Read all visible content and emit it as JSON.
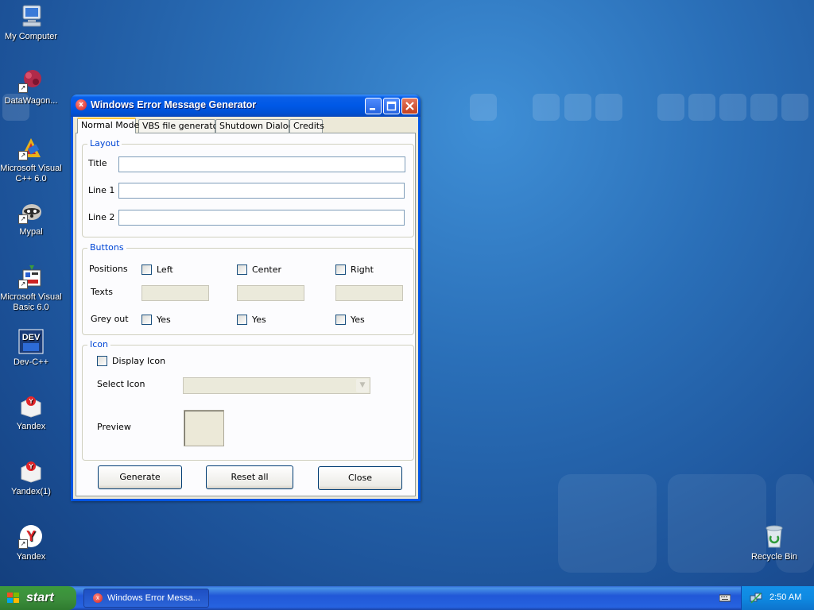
{
  "desktop": {
    "icons": [
      {
        "label": "My Computer"
      },
      {
        "label": "DataWagon..."
      },
      {
        "label": "Microsoft Visual C++ 6.0"
      },
      {
        "label": "Mypal"
      },
      {
        "label": "Microsoft Visual Basic 6.0"
      },
      {
        "label": "Dev-C++"
      },
      {
        "label": "Yandex"
      },
      {
        "label": "Yandex(1)"
      },
      {
        "label": "Yandex"
      },
      {
        "label": "Recycle Bin"
      }
    ]
  },
  "window": {
    "title": "Windows Error Message Generator",
    "tabs": [
      {
        "label": "Normal Mode",
        "active": true
      },
      {
        "label": "VBS file generator",
        "active": false
      },
      {
        "label": "Shutdown Dialog",
        "active": false
      },
      {
        "label": "Credits",
        "active": false
      }
    ],
    "layout_group": {
      "legend": "Layout",
      "title_label": "Title",
      "title_value": "",
      "line1_label": "Line 1",
      "line1_value": "",
      "line2_label": "Line 2",
      "line2_value": ""
    },
    "buttons_group": {
      "legend": "Buttons",
      "positions_label": "Positions",
      "texts_label": "Texts",
      "greyout_label": "Grey out",
      "left_label": "Left",
      "center_label": "Center",
      "right_label": "Right",
      "yes_label": "Yes"
    },
    "icon_group": {
      "legend": "Icon",
      "display_icon_label": "Display Icon",
      "select_icon_label": "Select Icon",
      "select_icon_value": "",
      "preview_label": "Preview"
    },
    "actions": {
      "generate": "Generate",
      "reset": "Reset all",
      "close": "Close"
    }
  },
  "taskbar": {
    "start_label": "start",
    "task_button_label": "Windows Error Messa...",
    "clock": "2:50 AM"
  },
  "colors": {
    "xp_blue": "#0055e5",
    "group_legend": "#0046d5",
    "start_green": "#3c8f3c",
    "tray_blue": "#0f8ae2"
  }
}
